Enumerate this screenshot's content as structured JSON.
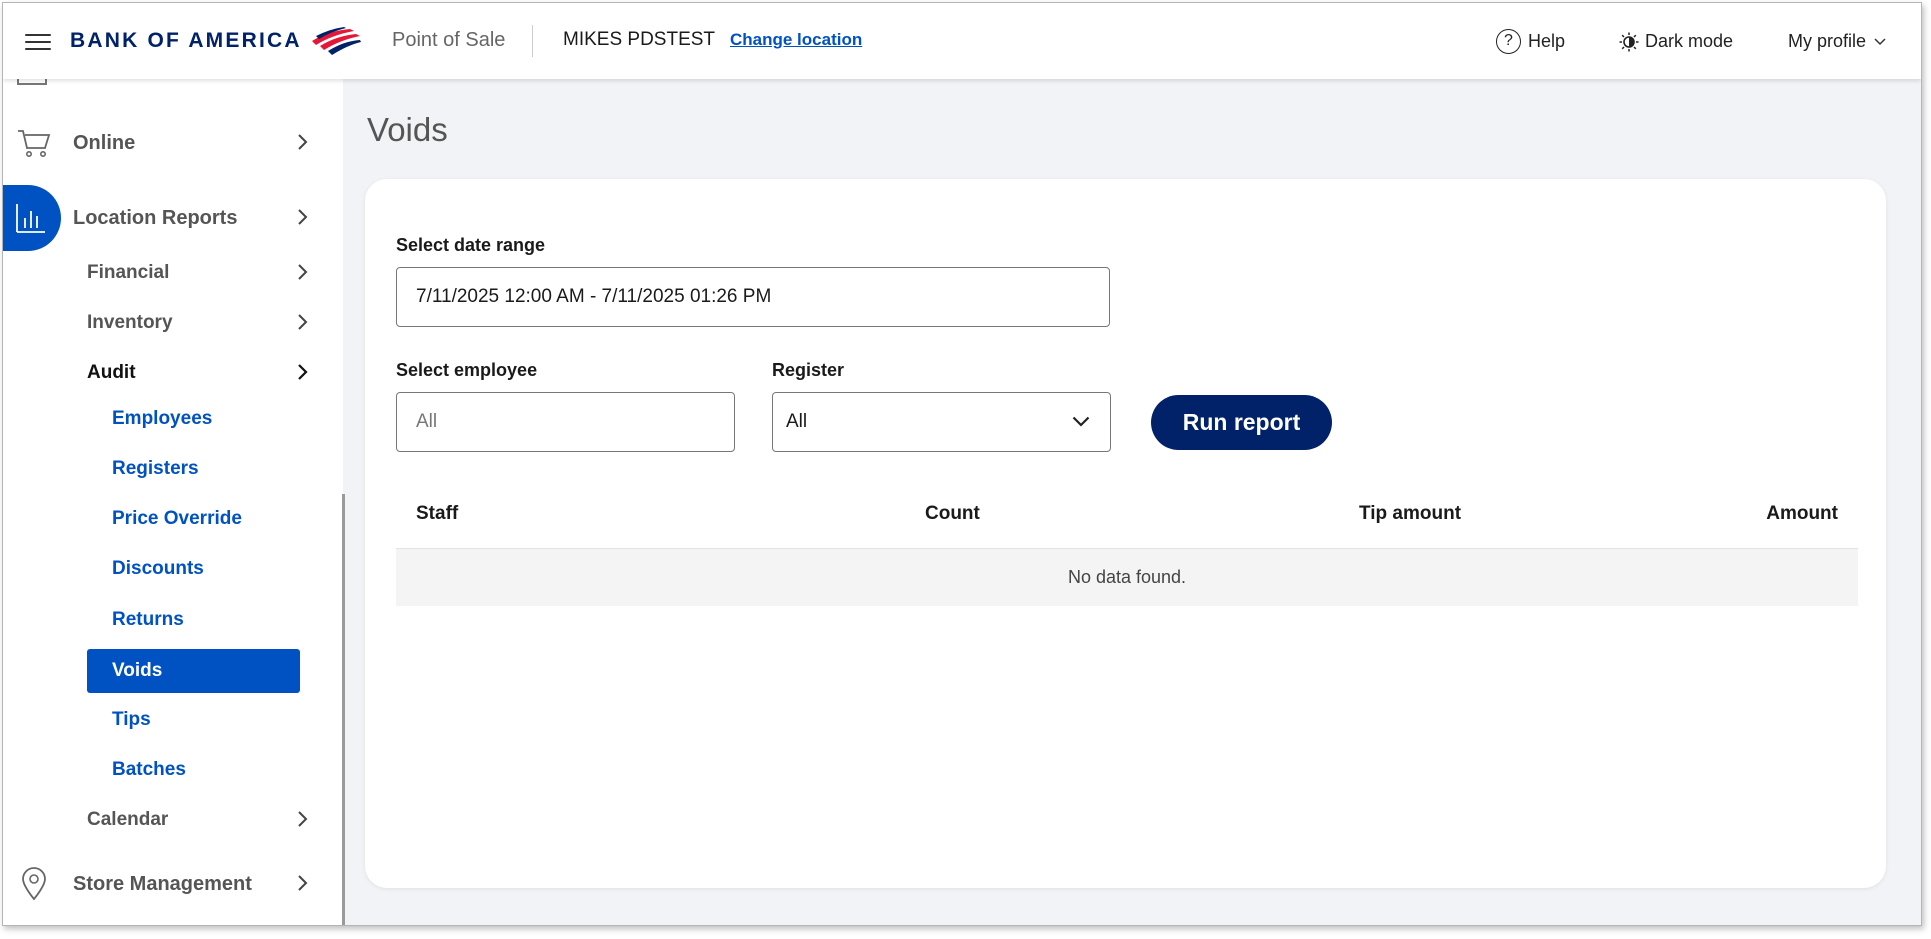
{
  "header": {
    "logo_text": "BANK OF AMERICA",
    "app_label": "Point of Sale",
    "store_name": "MIKES PDSTEST",
    "change_location": "Change location",
    "help": "Help",
    "dark_mode": "Dark mode",
    "profile": "My profile"
  },
  "sidebar": {
    "online": "Online",
    "location_reports": "Location Reports",
    "financial": "Financial",
    "inventory": "Inventory",
    "audit": "Audit",
    "audit_items": [
      "Employees",
      "Registers",
      "Price Override",
      "Discounts",
      "Returns",
      "Voids",
      "Tips",
      "Batches"
    ],
    "calendar": "Calendar",
    "store_management": "Store Management"
  },
  "main": {
    "title": "Voids",
    "date_range_label": "Select date range",
    "date_range_value": "7/11/2025 12:00 AM - 7/11/2025 01:26 PM",
    "employee_label": "Select employee",
    "employee_placeholder": "All",
    "register_label": "Register",
    "register_value": "All",
    "run_report": "Run report",
    "columns": [
      "Staff",
      "Count",
      "Tip amount",
      "Amount"
    ],
    "no_data": "No data found."
  },
  "colors": {
    "brand_navy": "#012169",
    "brand_red": "#e31837",
    "accent_blue": "#0052c2"
  }
}
